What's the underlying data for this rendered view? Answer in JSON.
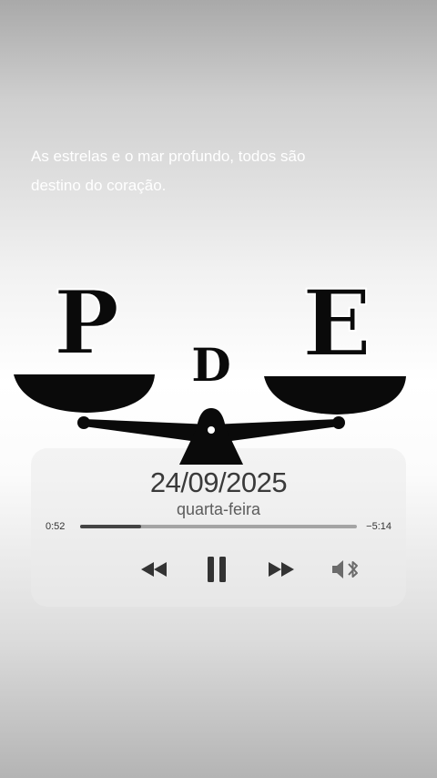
{
  "quote": {
    "line1": "As estrelas e o mar profundo, todos são",
    "line2": "destino do coração."
  },
  "logo": {
    "left_letter": "P",
    "center_letter": "D",
    "right_letter": "E"
  },
  "player": {
    "date": "24/09/2025",
    "weekday": "quarta-feira",
    "elapsed": "0:52",
    "remaining": "−5:14",
    "progress_fraction": 0.22,
    "controls": [
      "rewind-icon",
      "pause-icon",
      "fast-forward-icon",
      "speaker-bluetooth-icon"
    ]
  },
  "colors": {
    "background_top": "#a9a9a9",
    "background_mid": "#ffffff",
    "background_bottom": "#b4b4b4",
    "logo": "#0a0a0a"
  }
}
